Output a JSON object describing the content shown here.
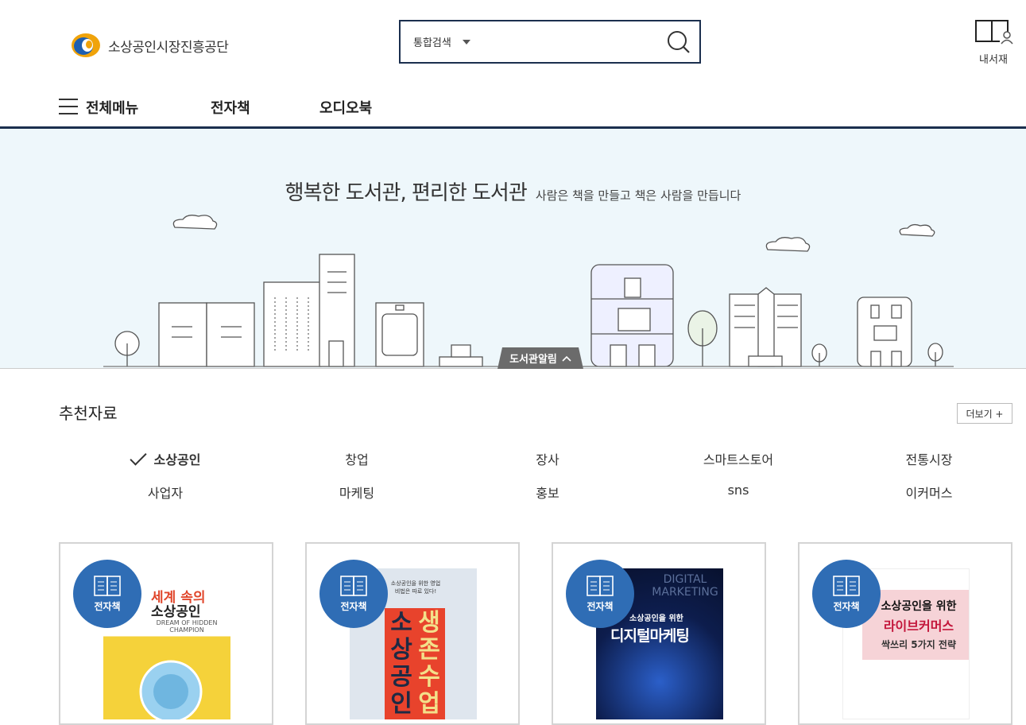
{
  "header": {
    "logo_text": "소상공인시장진흥공단",
    "search_scope": "통합검색",
    "search_placeholder": "",
    "my_library": "내서재"
  },
  "nav": {
    "all_menu": "전체메뉴",
    "items": [
      "전자책",
      "오디오북"
    ]
  },
  "banner": {
    "title": "행복한 도서관, 편리한 도서관",
    "subtitle": "사람은 책을 만들고 책은 사람을 만듭니다",
    "notice_tab": "도서관알림"
  },
  "recommended": {
    "title": "추천자료",
    "more": "더보기 +",
    "categories_row1": [
      "소상공인",
      "창업",
      "장사",
      "스마트스토어",
      "전통시장"
    ],
    "categories_row2": [
      "사업자",
      "마케팅",
      "홍보",
      "sns",
      "이커머스"
    ],
    "active_category": "소상공인",
    "books": [
      {
        "badge": "전자책",
        "cover_title_1": "세계 속의",
        "cover_title_2": "소상공인",
        "cover_sub": "DREAM OF HIDDEN CHAMPION"
      },
      {
        "badge": "전자책",
        "cover_title_1": "생존수업",
        "cover_title_2": "소상공인",
        "cover_sub": "소상공인을 위한 영업 비법은 따로 있다!"
      },
      {
        "badge": "전자책",
        "cover_title_1": "디지털마케팅",
        "cover_title_2": "소상공인을 위한",
        "cover_sub": "DIGITAL MARKETING"
      },
      {
        "badge": "전자책",
        "cover_title_1": "소상공인을 위한",
        "cover_title_2": "라이브커머스",
        "cover_sub": "싹쓰리 5가지 전략"
      }
    ]
  },
  "colors": {
    "navy": "#1b2f4e",
    "badge_blue": "#2f6db5",
    "banner_bg": "#eef7fb"
  }
}
